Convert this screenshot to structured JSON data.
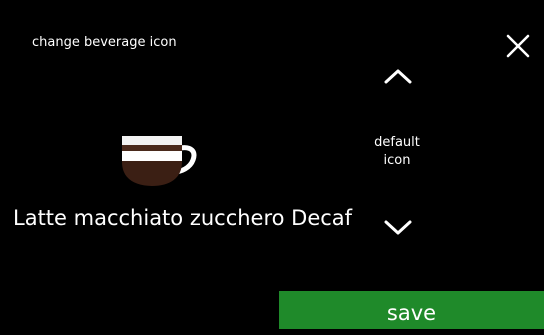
{
  "header": {
    "title": "change beverage icon",
    "close_icon": "close-icon"
  },
  "preview": {
    "icon": "cup-icon",
    "beverage_name": "Latte macchiato zucchero Decaf"
  },
  "selector": {
    "up_icon": "chevron-up-icon",
    "current_label_line1": "default",
    "current_label_line2": "icon",
    "down_icon": "chevron-down-icon"
  },
  "footer": {
    "save_label": "save",
    "save_color": "#1f8a2a"
  },
  "colors": {
    "background": "#000000",
    "text": "#ffffff",
    "cup_coffee": "#3b1f14",
    "cup_milk": "#ffffff",
    "cup_foam": "#f3f3f3"
  }
}
